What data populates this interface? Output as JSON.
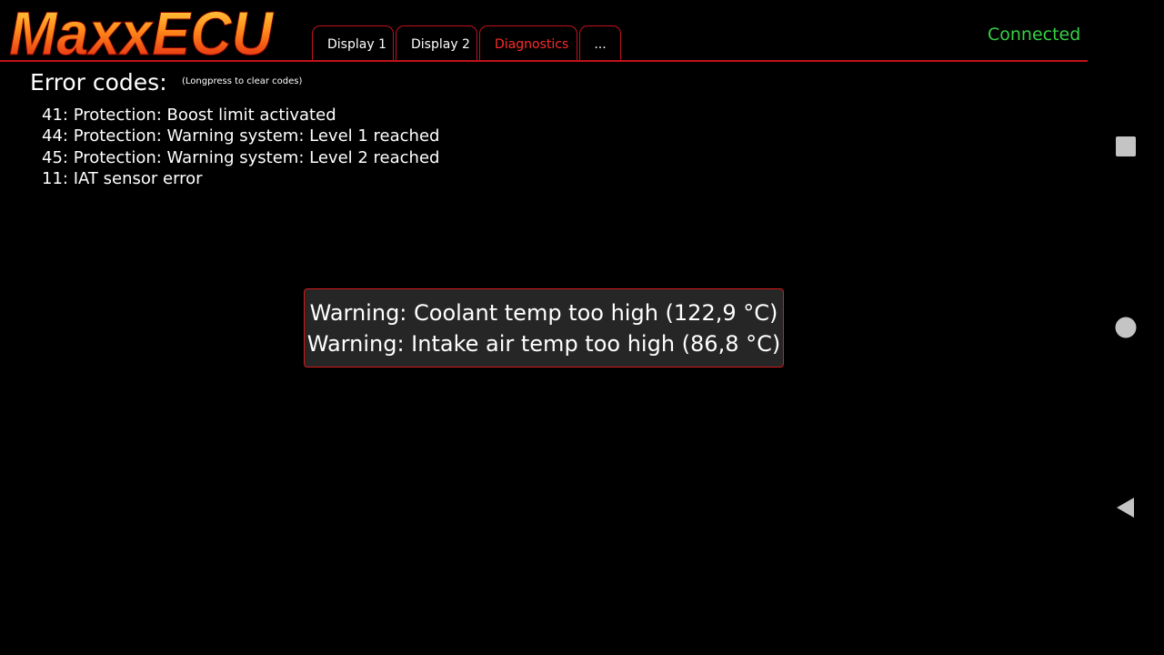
{
  "app": {
    "logo_text": "MaxxECU",
    "status": "Connected"
  },
  "tabs": [
    {
      "label": "Display 1",
      "active": false
    },
    {
      "label": "Display 2",
      "active": false
    },
    {
      "label": "Diagnostics",
      "active": true
    },
    {
      "label": "...",
      "active": false
    }
  ],
  "diagnostics": {
    "title": "Error codes:",
    "hint": "(Longpress to clear codes)",
    "codes": [
      "41: Protection: Boost limit activated",
      "44: Protection: Warning system: Level 1 reached",
      "45: Protection: Warning system: Level 2 reached",
      "11: IAT sensor error"
    ]
  },
  "warnings": [
    "Warning: Coolant temp too high (122,9 °C)",
    "Warning: Intake air temp too high (86,8 °C)"
  ],
  "navbar": {
    "icons": [
      "recents-square-icon",
      "home-circle-icon",
      "back-triangle-icon"
    ]
  },
  "colors": {
    "accent": "#c0121a",
    "active_tab": "#ff2a2a",
    "connected": "#35d047",
    "warning_bg": "#262626"
  }
}
